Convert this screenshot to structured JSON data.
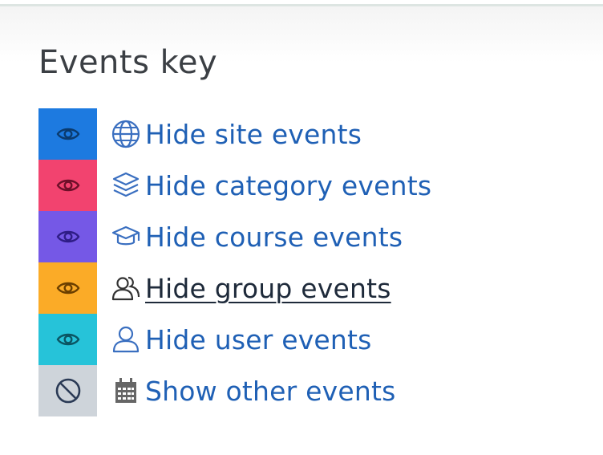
{
  "title": "Events key",
  "events": [
    {
      "label": "Hide site events",
      "type_icon": "globe-icon",
      "toggle_icon": "eye-icon",
      "color": "#1d7ae0"
    },
    {
      "label": "Hide category events",
      "type_icon": "layers-icon",
      "toggle_icon": "eye-icon",
      "color": "#f2436f"
    },
    {
      "label": "Hide course events",
      "type_icon": "graduation-cap-icon",
      "toggle_icon": "eye-icon",
      "color": "#7558e6"
    },
    {
      "label": "Hide group events",
      "type_icon": "users-icon",
      "toggle_icon": "eye-icon",
      "color": "#fbab27"
    },
    {
      "label": "Hide user events",
      "type_icon": "user-icon",
      "toggle_icon": "eye-icon",
      "color": "#26c3d9"
    },
    {
      "label": "Show other events",
      "type_icon": "calendar-icon",
      "toggle_icon": "ban-icon",
      "color": "#ced4da"
    }
  ]
}
